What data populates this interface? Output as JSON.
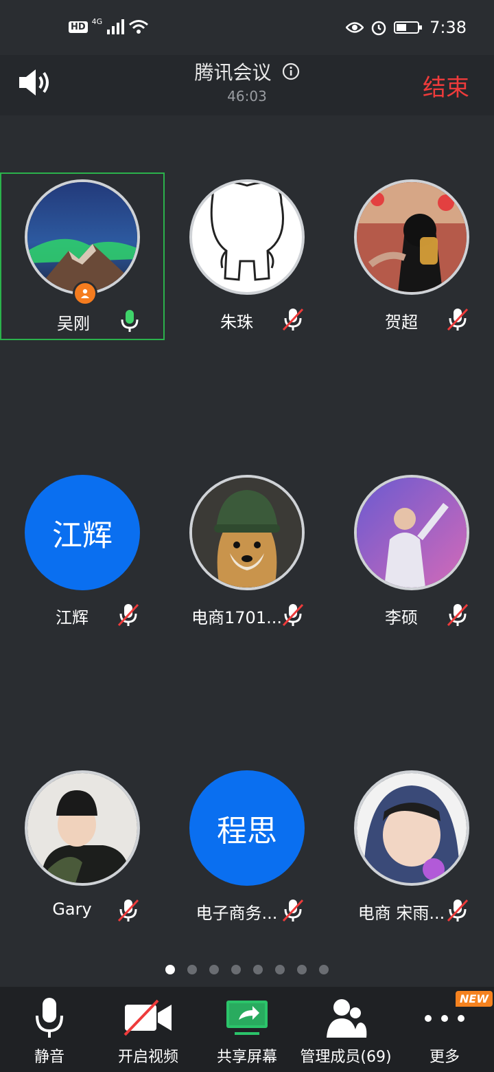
{
  "status_bar": {
    "time": "7:38",
    "hd": "HD",
    "network": "4G"
  },
  "header": {
    "title": "腾讯会议",
    "timer": "46:03",
    "end_label": "结束"
  },
  "participants": [
    {
      "name": "吴刚",
      "avatar": "photo-aurora-mountain",
      "mic": "on",
      "host": true,
      "active": true
    },
    {
      "name": "朱珠",
      "avatar": "drawing-cartoon-figure",
      "mic": "muted"
    },
    {
      "name": "贺超",
      "avatar": "photo-person-drinking",
      "mic": "muted"
    },
    {
      "name": "江辉",
      "avatar_text": "江辉",
      "mic": "muted"
    },
    {
      "name": "电商1701...",
      "avatar": "photo-shiba-hat",
      "mic": "muted"
    },
    {
      "name": "李硕",
      "avatar": "photo-stage-performer",
      "mic": "muted"
    },
    {
      "name": "Gary",
      "avatar": "photo-child-hat",
      "mic": "muted"
    },
    {
      "name": "电子商务...",
      "avatar_text": "程思",
      "mic": "muted"
    },
    {
      "name": "电商 宋雨...",
      "avatar": "photo-girl-hood",
      "mic": "muted"
    }
  ],
  "pagination": {
    "total": 8,
    "current": 1
  },
  "toolbar": {
    "mute_label": "静音",
    "video_label": "开启视频",
    "share_label": "共享屏幕",
    "members_label": "管理成员(69)",
    "more_label": "更多",
    "new_badge": "NEW"
  },
  "colors": {
    "accent": "#0a6ff0",
    "end_red": "#ee3b3b",
    "active_green": "#2bb24c",
    "badge_orange": "#f5821f"
  }
}
